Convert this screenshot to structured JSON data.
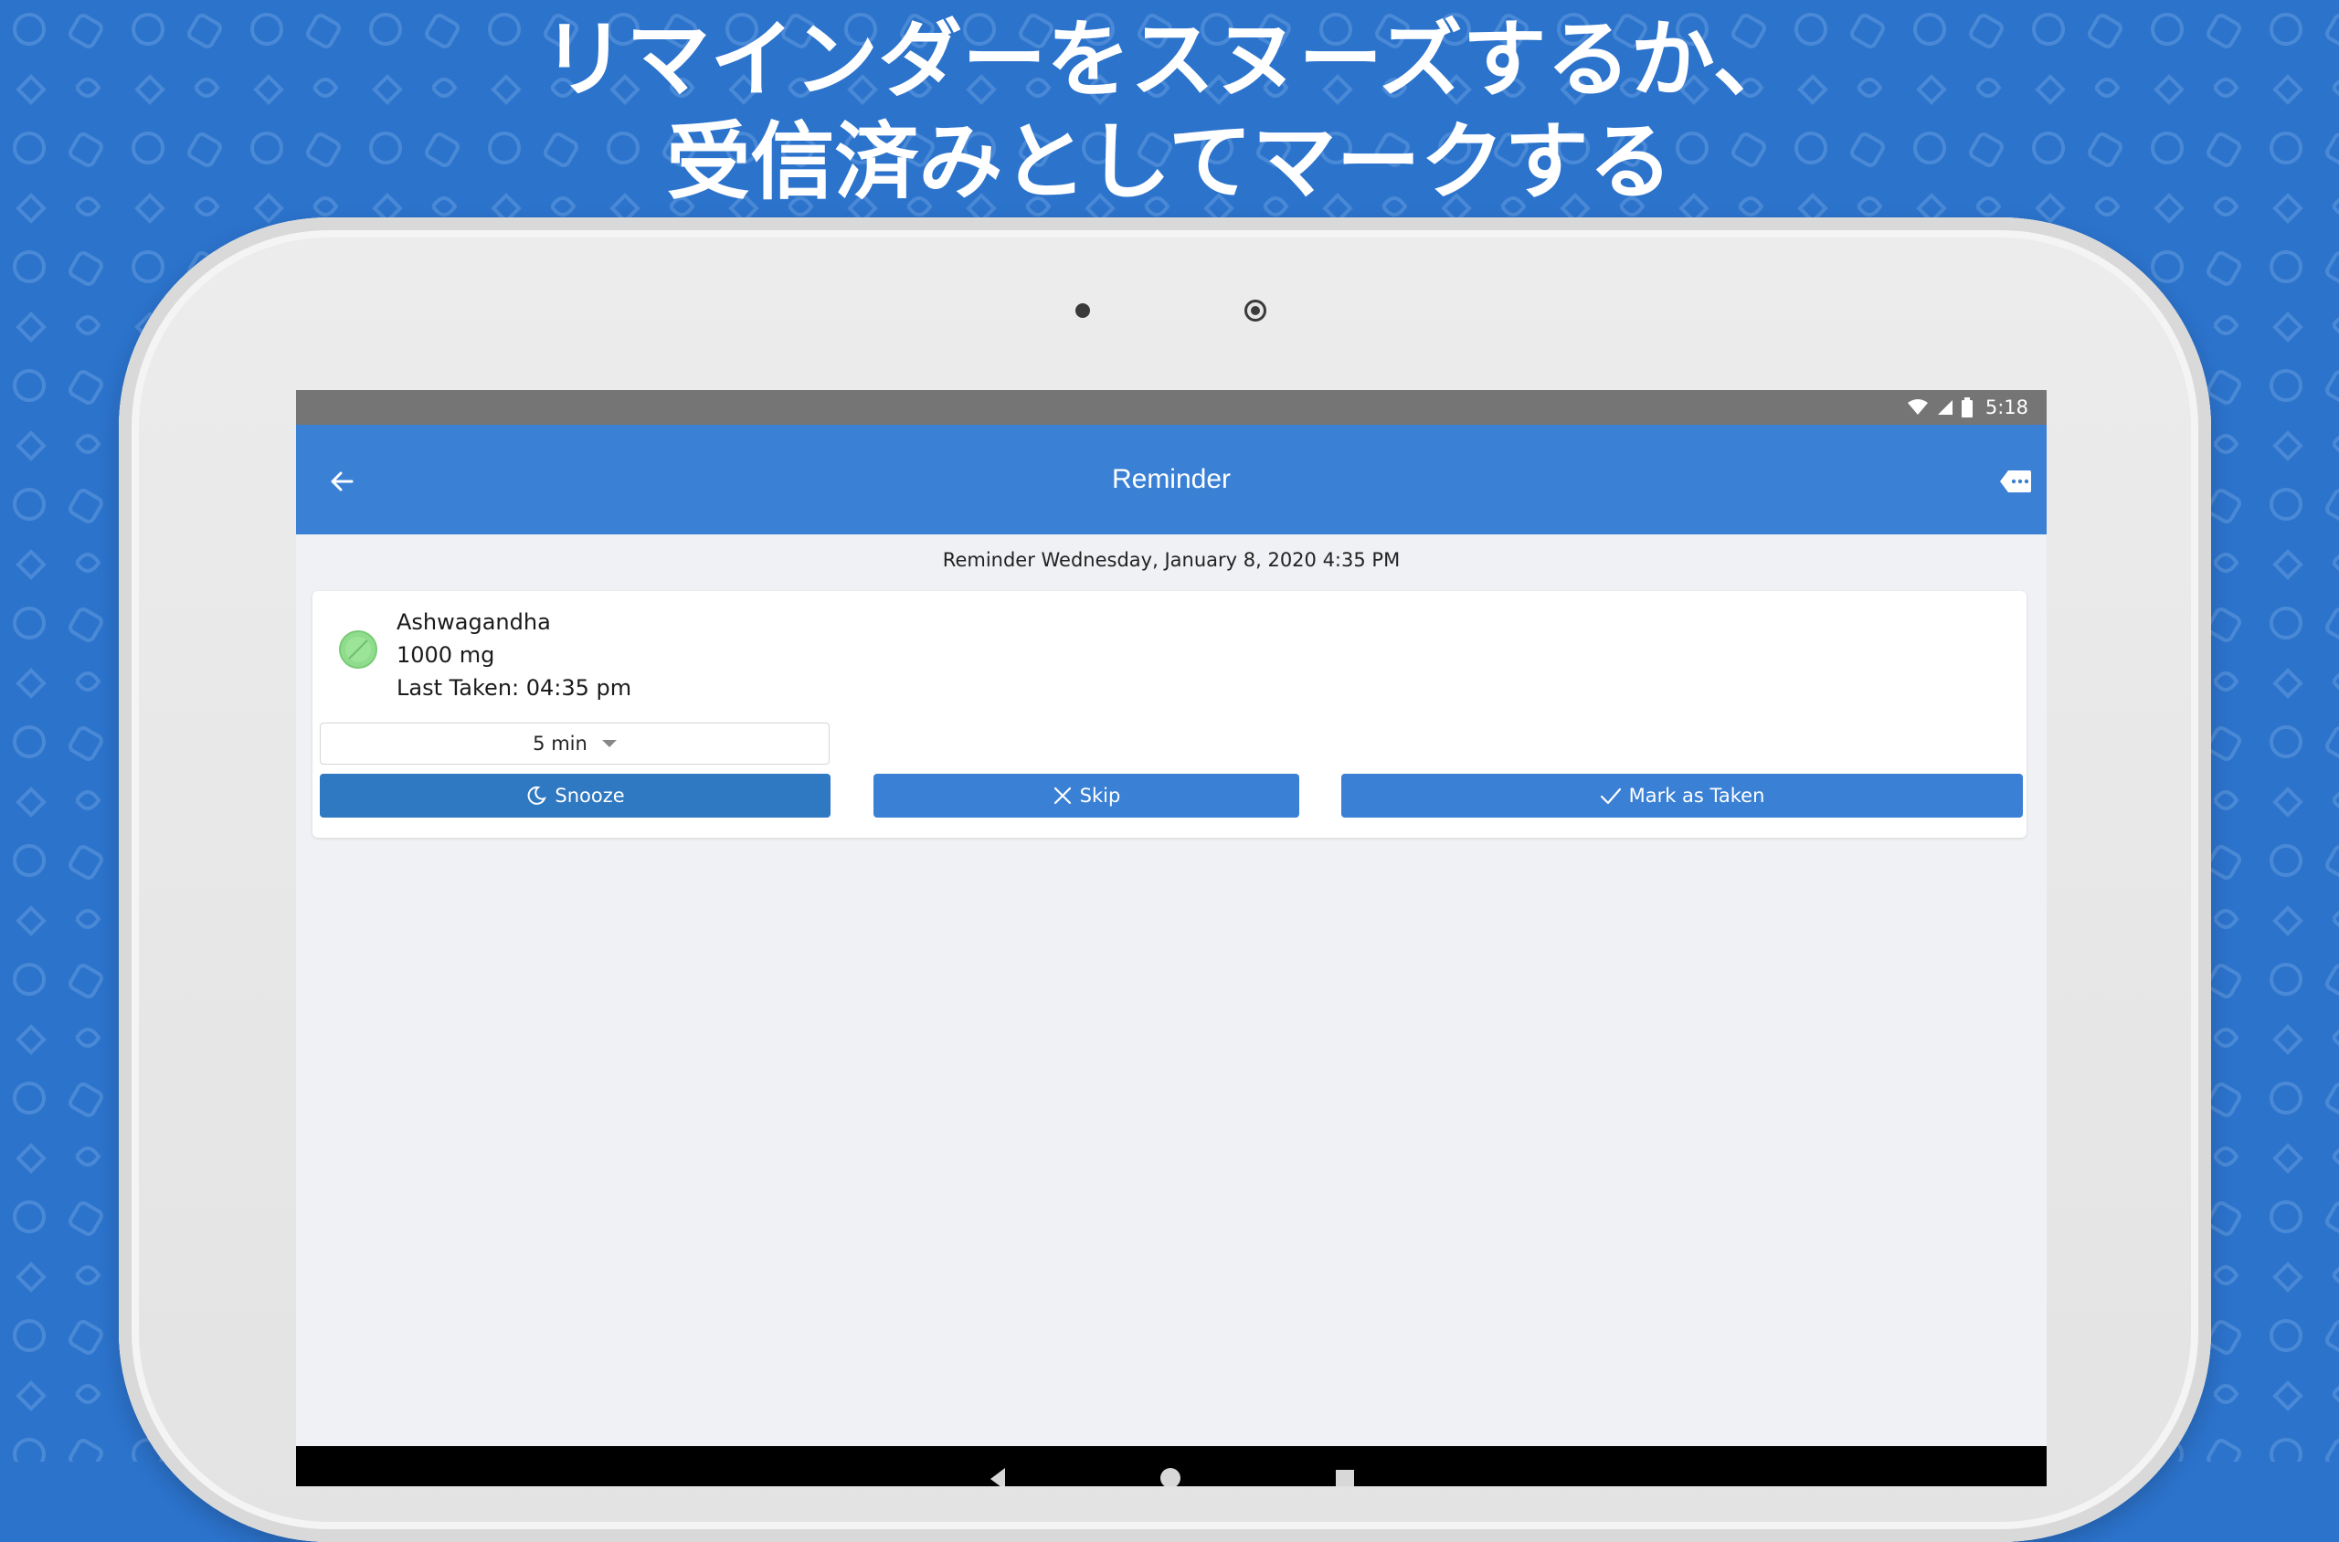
{
  "colors": {
    "background": "#2c73cc",
    "app_bar": "#3a80d4",
    "status_bar": "#757575",
    "snooze_button": "#2f78c2",
    "action_button": "#3a80d4",
    "pill": "#8fdc8c"
  },
  "headline": {
    "line1": "リマインダーをスヌーズするか、",
    "line2": "受信済みとしてマークする"
  },
  "status_bar": {
    "time": "5:18",
    "icons": [
      "wifi-icon",
      "signal-icon",
      "battery-icon"
    ]
  },
  "app_bar": {
    "title": "Reminder",
    "back_icon": "arrow-left-icon",
    "action_icon": "tag-icon"
  },
  "reminder": {
    "datetime_text": "Reminder Wednesday, January 8, 2020 4:35 PM"
  },
  "medication": {
    "name": "Ashwagandha",
    "dose": "1000 mg",
    "last_taken": "Last Taken: 04:35 pm",
    "icon": "pill-icon"
  },
  "snooze": {
    "selected": "5 min"
  },
  "actions": {
    "snooze_label": "Snooze",
    "snooze_icon": "moon-icon",
    "skip_label": "Skip",
    "skip_icon": "close-icon",
    "taken_label": "Mark as Taken",
    "taken_icon": "check-icon"
  }
}
